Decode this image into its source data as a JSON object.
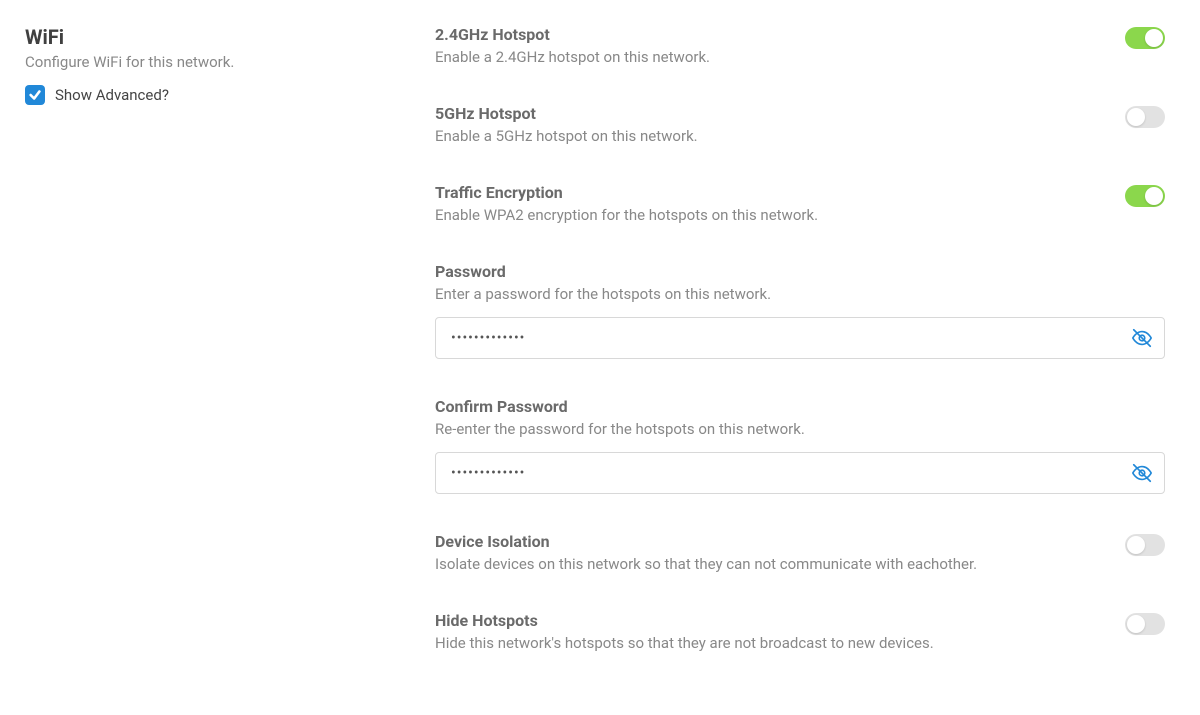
{
  "sidebar": {
    "title": "WiFi",
    "subtitle": "Configure WiFi for this network.",
    "show_advanced_label": "Show Advanced?",
    "show_advanced_checked": true
  },
  "settings": {
    "hotspot24": {
      "title": "2.4GHz Hotspot",
      "desc": "Enable a 2.4GHz hotspot on this network.",
      "enabled": true
    },
    "hotspot5": {
      "title": "5GHz Hotspot",
      "desc": "Enable a 5GHz hotspot on this network.",
      "enabled": false
    },
    "encryption": {
      "title": "Traffic Encryption",
      "desc": "Enable WPA2 encryption for the hotspots on this network.",
      "enabled": true
    },
    "password": {
      "title": "Password",
      "desc": "Enter a password for the hotspots on this network.",
      "value": "•••••••••••••"
    },
    "confirm_password": {
      "title": "Confirm Password",
      "desc": "Re-enter the password for the hotspots on this network.",
      "value": "•••••••••••••"
    },
    "isolation": {
      "title": "Device Isolation",
      "desc": "Isolate devices on this network so that they can not communicate with eachother.",
      "enabled": false
    },
    "hide": {
      "title": "Hide Hotspots",
      "desc": "Hide this network's hotspots so that they are not broadcast to new devices.",
      "enabled": false
    }
  }
}
